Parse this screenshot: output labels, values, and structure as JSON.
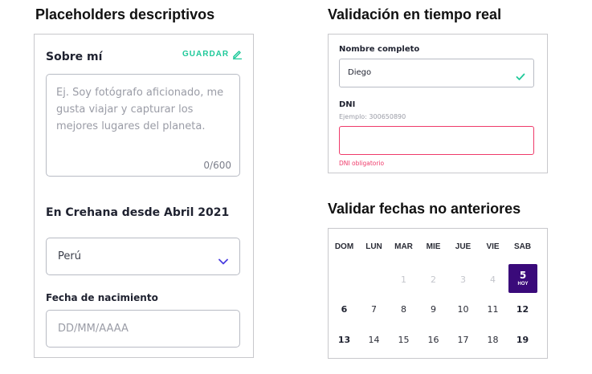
{
  "headings": {
    "left": "Placeholders descriptivos",
    "right_top": "Validación en tiempo real",
    "right_bottom": "Validar fechas no anteriores"
  },
  "profile_panel": {
    "about_title": "Sobre mí",
    "save_label": "GUARDAR",
    "save_icon": "pencil-icon",
    "bio_placeholder": "Ej. Soy fotógrafo aficionado, me gusta viajar y capturar los mejores lugares del planeta.",
    "char_counter": "0/600",
    "member_since": "En Crehana desde Abril 2021",
    "country_value": "Perú",
    "country_icon": "chevron-down-icon",
    "birth_label": "Fecha de nacimiento",
    "birth_placeholder": "DD/MM/AAAA",
    "accent_color": "#1fc99a",
    "chevron_color": "#4a3ee0"
  },
  "validation_panel": {
    "name_label": "Nombre completo",
    "name_value": "Diego",
    "name_valid_icon": "check-icon",
    "dni_label": "DNI",
    "dni_help": "Ejemplo: 300650890",
    "dni_value": "",
    "dni_error": "DNI obligatorio",
    "valid_color": "#1fc99a",
    "error_color": "#ef3a6a"
  },
  "calendar": {
    "weekdays": [
      "DOM",
      "LUN",
      "MAR",
      "MIE",
      "JUE",
      "VIE",
      "SAB"
    ],
    "week1": [
      "",
      "",
      "1",
      "2",
      "3",
      "4",
      "5"
    ],
    "week2": [
      "6",
      "7",
      "8",
      "9",
      "10",
      "11",
      "12"
    ],
    "week3": [
      "13",
      "14",
      "15",
      "16",
      "17",
      "18",
      "19"
    ],
    "today_day": "5",
    "today_label": "HOY",
    "today_color": "#3a0a7a"
  }
}
